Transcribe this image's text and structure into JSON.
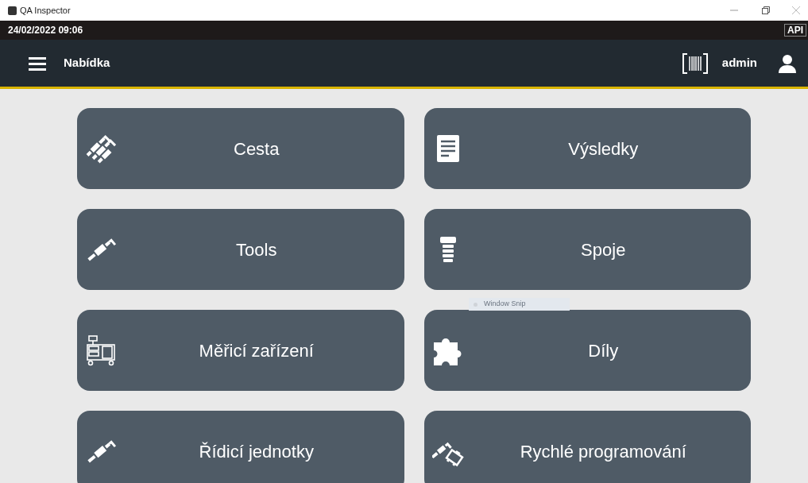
{
  "window": {
    "title": "QA Inspector"
  },
  "status_bar": {
    "datetime": "24/02/2022 09:06",
    "badge": "API"
  },
  "header": {
    "title": "Nabídka",
    "user": "admin"
  },
  "tiles": [
    {
      "label": "Cesta",
      "kind": "pipes"
    },
    {
      "label": "Výsledky",
      "kind": "document"
    },
    {
      "label": "Tools",
      "kind": "torch"
    },
    {
      "label": "Spoje",
      "kind": "screw"
    },
    {
      "label": "Měřicí zařízení",
      "kind": "cart"
    },
    {
      "label": "Díly",
      "kind": "puzzle"
    },
    {
      "label": "Řídicí jednotky",
      "kind": "torch"
    },
    {
      "label": "Rychlé programování",
      "kind": "robot"
    }
  ],
  "overlay_tooltip": "Window Snip"
}
